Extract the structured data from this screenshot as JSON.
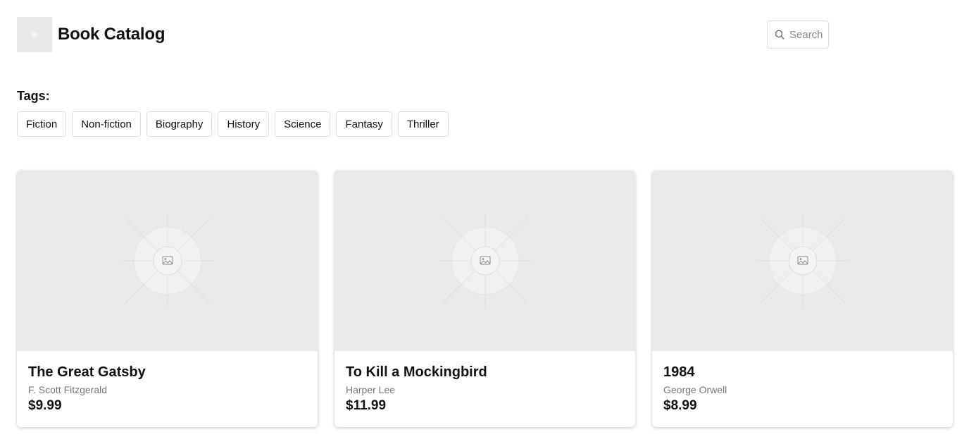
{
  "header": {
    "title": "Book Catalog",
    "logo_icon": "image-placeholder-icon",
    "search": {
      "placeholder": "Search",
      "icon": "search-icon"
    }
  },
  "tags": {
    "label": "Tags:",
    "items": [
      "Fiction",
      "Non-fiction",
      "Biography",
      "History",
      "Science",
      "Fantasy",
      "Thriller"
    ]
  },
  "books": [
    {
      "title": "The Great Gatsby",
      "author": "F. Scott Fitzgerald",
      "price": "$9.99",
      "cover_icon": "image-placeholder-icon"
    },
    {
      "title": "To Kill a Mockingbird",
      "author": "Harper Lee",
      "price": "$11.99",
      "cover_icon": "image-placeholder-icon"
    },
    {
      "title": "1984",
      "author": "George Orwell",
      "price": "$8.99",
      "cover_icon": "image-placeholder-icon"
    }
  ],
  "colors": {
    "background": "#ffffff",
    "placeholder": "#e9e9e9",
    "border": "#dedede",
    "muted_text": "#777777"
  }
}
